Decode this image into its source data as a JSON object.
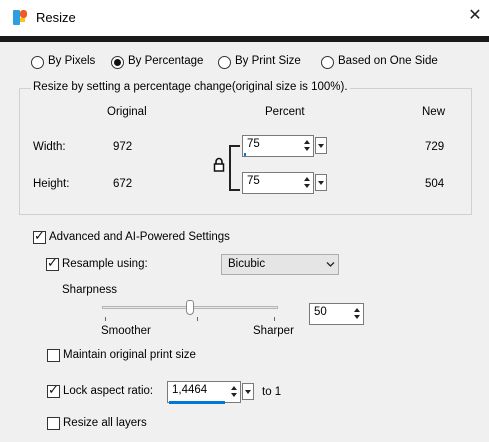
{
  "window": {
    "title": "Resize",
    "close_glyph": "✕"
  },
  "modes": [
    {
      "label": "By Pixels",
      "checked": false
    },
    {
      "label": "By Percentage",
      "checked": true
    },
    {
      "label": "By Print Size",
      "checked": false
    },
    {
      "label": "Based on One Side",
      "checked": false
    }
  ],
  "percent_group": {
    "caption": "Resize by setting a percentage change(original size is 100%).",
    "headers": {
      "original": "Original",
      "percent": "Percent",
      "new": "New"
    },
    "width": {
      "label": "Width:",
      "original": "972",
      "percent": "75",
      "new": "729"
    },
    "height": {
      "label": "Height:",
      "original": "672",
      "percent": "75",
      "new": "504"
    },
    "link_icon": "padlock-icon"
  },
  "advanced": {
    "label": "Advanced and AI-Powered Settings",
    "checked": true
  },
  "resample": {
    "label": "Resample using:",
    "checked": true,
    "method": "Bicubic"
  },
  "sharpness": {
    "label": "Sharpness",
    "value": "50",
    "min_label": "Smoother",
    "max_label": "Sharper",
    "level": 0.5
  },
  "maintain_print": {
    "label": "Maintain original print size",
    "checked": false
  },
  "aspect": {
    "label": "Lock aspect ratio:",
    "checked": true,
    "value": "1,4464",
    "suffix": "to 1"
  },
  "all_layers": {
    "label": "Resize all layers",
    "checked": false
  },
  "colors": {
    "accent": "#0078d7",
    "window_bg": "#f0f0f0"
  }
}
